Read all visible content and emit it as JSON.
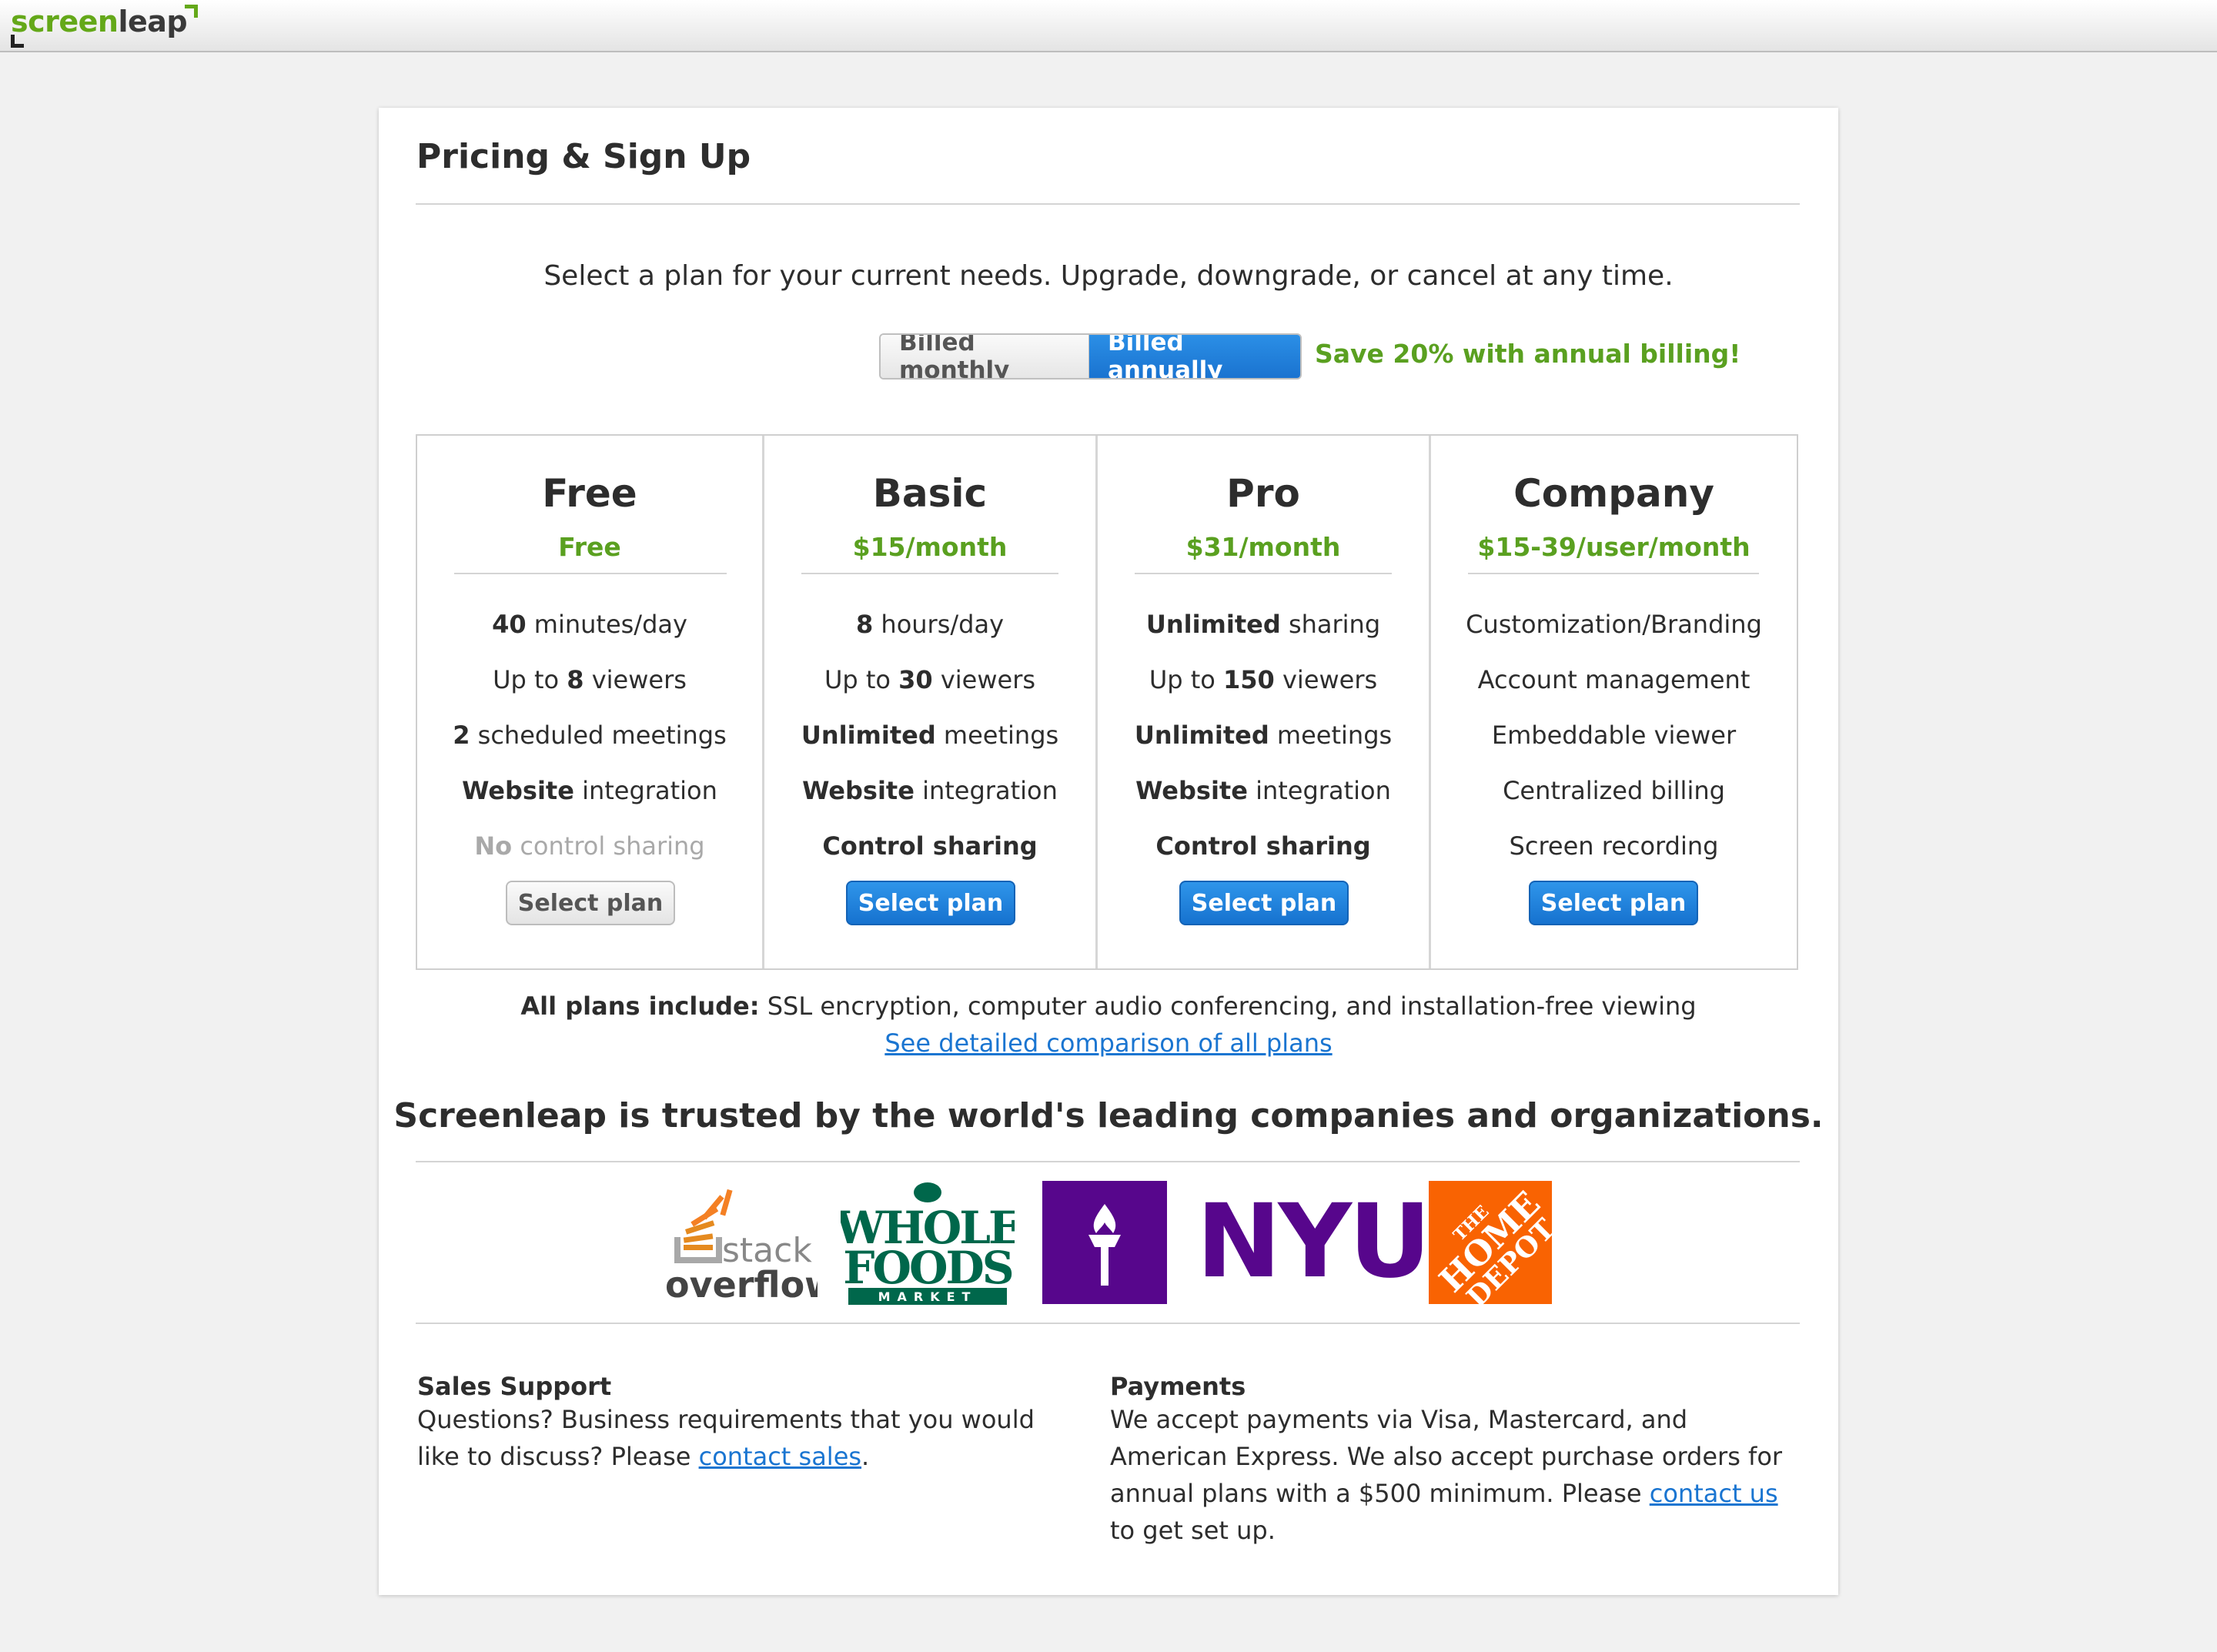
{
  "app": {
    "logo_part1": "screen",
    "logo_part2": "leap"
  },
  "page": {
    "title": "Pricing & Sign Up",
    "intro": "Select a plan for your current needs. Upgrade, downgrade, or cancel at any time.",
    "billing": {
      "monthly_label": "Billed monthly",
      "annual_label": "Billed annually",
      "selected": "annual",
      "save_note": "Save 20% with annual billing!"
    }
  },
  "plans": [
    {
      "name": "Free",
      "price": "Free",
      "features": [
        {
          "bold": "40",
          "text": " minutes/day"
        },
        {
          "pre": "Up to ",
          "bold": "8",
          "text": " viewers"
        },
        {
          "bold": "2",
          "text": " scheduled meetings"
        },
        {
          "bold": "Website",
          "text": " integration"
        },
        {
          "bold": "No",
          "text": " control sharing",
          "muted": true
        }
      ],
      "button": "Select plan",
      "button_style": "grey"
    },
    {
      "name": "Basic",
      "price": "$15/month",
      "features": [
        {
          "bold": "8",
          "text": " hours/day"
        },
        {
          "pre": "Up to ",
          "bold": "30",
          "text": " viewers"
        },
        {
          "bold": "Unlimited",
          "text": " meetings"
        },
        {
          "bold": "Website",
          "text": " integration"
        },
        {
          "bold": "Control sharing",
          "text": ""
        }
      ],
      "button": "Select plan",
      "button_style": "blue"
    },
    {
      "name": "Pro",
      "price": "$31/month",
      "features": [
        {
          "bold": "Unlimited",
          "text": " sharing"
        },
        {
          "pre": "Up to ",
          "bold": "150",
          "text": " viewers"
        },
        {
          "bold": "Unlimited",
          "text": " meetings"
        },
        {
          "bold": "Website",
          "text": " integration"
        },
        {
          "bold": "Control sharing",
          "text": ""
        }
      ],
      "button": "Select plan",
      "button_style": "blue"
    },
    {
      "name": "Company",
      "price": "$15-39/user/month",
      "features": [
        {
          "text": "Customization/Branding"
        },
        {
          "text": "Account management"
        },
        {
          "text": "Embeddable viewer"
        },
        {
          "text": "Centralized billing"
        },
        {
          "text": "Screen recording"
        }
      ],
      "button": "Select plan",
      "button_style": "blue"
    }
  ],
  "all_plans": {
    "label": "All plans include:",
    "text": " SSL encryption, computer audio conferencing, and installation-free viewing"
  },
  "compare_link": "See detailed comparison of all plans",
  "trusted": "Screenleap is trusted by the world's leading companies and organizations.",
  "logos": {
    "stackoverflow": {
      "line1": "stack",
      "line2": "overflow"
    },
    "wholefoods": {
      "line1": "WHOLE",
      "line2": "FOODS",
      "line3": "MARKET"
    },
    "nyu": "NYU",
    "homedepot": {
      "line1": "THE",
      "line2": "HOME",
      "line3": "DEPOT"
    }
  },
  "sales": {
    "title": "Sales Support",
    "text_before": "Questions? Business requirements that you would like to discuss? Please ",
    "link": "contact sales",
    "text_after": "."
  },
  "payments": {
    "title": "Payments",
    "text_before": "We accept payments via Visa, Mastercard, and American Express. We also accept purchase orders for annual plans with a $500 minimum. Please ",
    "link": "contact us",
    "text_after": " to get set up."
  },
  "colors": {
    "accent_green": "#5aa020",
    "button_blue": "#1a73d0",
    "nyu_purple": "#57068c",
    "homedepot_orange": "#f96302"
  }
}
